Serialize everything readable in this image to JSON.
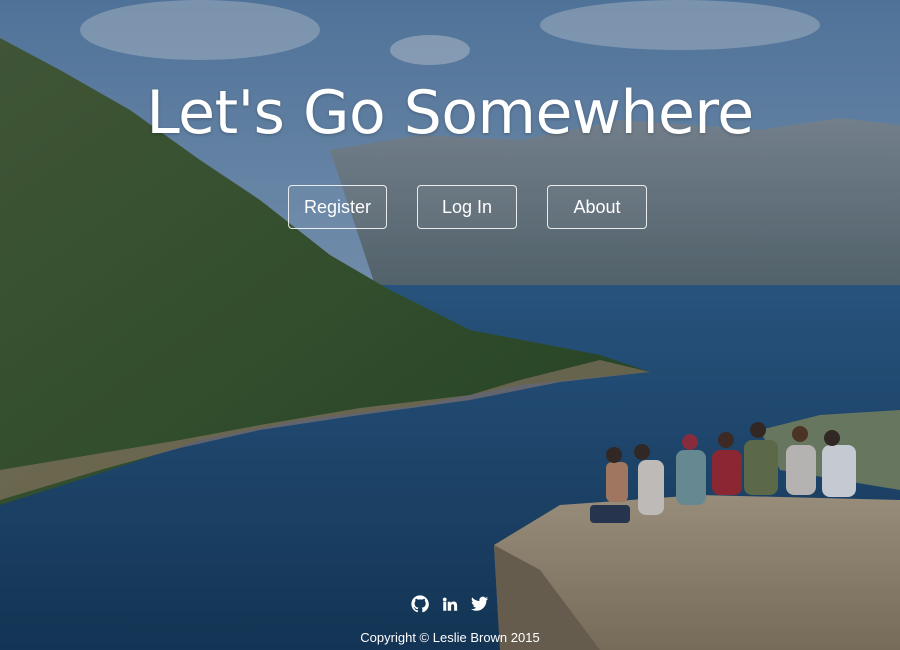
{
  "hero": {
    "title": "Let's Go Somewhere"
  },
  "nav": {
    "register": "Register",
    "login": "Log In",
    "about": "About"
  },
  "footer": {
    "social": [
      "github-icon",
      "linkedin-icon",
      "twitter-icon"
    ],
    "copyright": "Copyright © Leslie Brown 2015"
  },
  "colors": {
    "sky": "#5b7fa6",
    "water": "#1f4d74",
    "mountain": "#3f5e38",
    "text": "#ffffff"
  }
}
